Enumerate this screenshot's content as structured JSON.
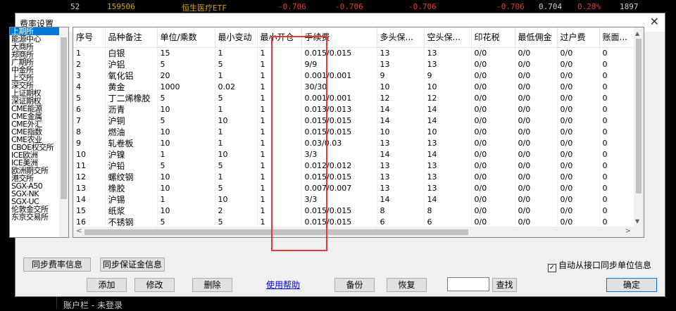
{
  "background": {
    "top_values": [
      "52",
      "159506",
      "恒生医疗ETF",
      "-0.706",
      "-0.706",
      "-0.706",
      "-0.706",
      "0.704",
      "0.28%",
      "1897"
    ],
    "status_text": "账户栏 - 未登录"
  },
  "dialog": {
    "title": "费率设置",
    "close_icon": "✕"
  },
  "exchanges": {
    "items": [
      "上期所",
      "能源中心",
      "大商所",
      "郑商所",
      "广期所",
      "中金所",
      "上交所",
      "深交所",
      "上证期权",
      "深证期权",
      "CME能源",
      "CME金属",
      "CME外汇",
      "CME指数",
      "CME农业",
      "CBOE权交所",
      "ICE欧洲",
      "ICE美洲",
      "欧洲期交所",
      "港交所",
      "SGX-A50",
      "SGX-NK",
      "SGX-UC",
      "伦敦金交所",
      "东京交易所"
    ],
    "selected_index": 0
  },
  "table": {
    "columns": [
      "序号",
      "品种备注",
      "单位/乘数",
      "最小变动",
      "最小开仓",
      "手续费",
      "多头保...",
      "空头保...",
      "印花税",
      "最低佣金",
      "过户费",
      "账面..."
    ],
    "rows": [
      [
        "1",
        "白银",
        "15",
        "1",
        "1",
        "0.015/0.015",
        "13",
        "13",
        "0/0",
        "0/0",
        "0/0",
        "0"
      ],
      [
        "2",
        "沪铝",
        "5",
        "5",
        "1",
        "9/9",
        "13",
        "13",
        "0/0",
        "0/0",
        "0/0",
        "0"
      ],
      [
        "3",
        "氧化铝",
        "20",
        "1",
        "1",
        "0.001/0.001",
        "9",
        "9",
        "0/0",
        "0/0",
        "0/0",
        "0"
      ],
      [
        "4",
        "黄金",
        "1000",
        "0.02",
        "1",
        "30/30",
        "10",
        "10",
        "0/0",
        "0/0",
        "0/0",
        "0"
      ],
      [
        "5",
        "丁二烯橡胶",
        "5",
        "5",
        "1",
        "0.001/0.001",
        "12",
        "12",
        "0/0",
        "0/0",
        "0/0",
        "0"
      ],
      [
        "6",
        "沥青",
        "10",
        "1",
        "1",
        "0.013/0.013",
        "14",
        "14",
        "0/0",
        "0/0",
        "0/0",
        "0"
      ],
      [
        "7",
        "沪铜",
        "5",
        "10",
        "1",
        "0.015/0.015",
        "14",
        "14",
        "0/0",
        "0/0",
        "0/0",
        "0"
      ],
      [
        "8",
        "燃油",
        "10",
        "1",
        "1",
        "0.015/0.015",
        "10",
        "10",
        "0/0",
        "0/0",
        "0/0",
        "0"
      ],
      [
        "9",
        "轧卷板",
        "10",
        "1",
        "1",
        "0.03/0.03",
        "13",
        "13",
        "0/0",
        "0/0",
        "0/0",
        "0"
      ],
      [
        "10",
        "沪镍",
        "1",
        "10",
        "1",
        "3/3",
        "14",
        "14",
        "0/0",
        "0/0",
        "0/0",
        "0"
      ],
      [
        "11",
        "沪铅",
        "5",
        "5",
        "1",
        "0.012/0.012",
        "13",
        "13",
        "0/0",
        "0/0",
        "0/0",
        "0"
      ],
      [
        "12",
        "螺纹钢",
        "10",
        "1",
        "1",
        "0.015/0.015",
        "13",
        "13",
        "0/0",
        "0/0",
        "0/0",
        "0"
      ],
      [
        "13",
        "橡胶",
        "10",
        "5",
        "1",
        "0.007/0.007",
        "13",
        "13",
        "0/0",
        "0/0",
        "0/0",
        "0"
      ],
      [
        "14",
        "沪锡",
        "1",
        "10",
        "1",
        "3/3",
        "14",
        "14",
        "0/0",
        "0/0",
        "0/0",
        "0"
      ],
      [
        "15",
        "纸浆",
        "10",
        "2",
        "1",
        "0.015/0.015",
        "8",
        "8",
        "0/0",
        "0/0",
        "0/0",
        "0"
      ],
      [
        "16",
        "不锈钢",
        "5",
        "5",
        "1",
        "0.015/0.015",
        "6",
        "6",
        "0/0",
        "0/0",
        "0/0",
        "0"
      ]
    ]
  },
  "buttons": {
    "sync_rates": "同步费率信息",
    "sync_margin": "同步保证金信息",
    "auto_sync_label": "自动从接口同步单位信息",
    "auto_sync_checked": true,
    "add": "添加",
    "edit": "修改",
    "delete": "删除",
    "help": "使用帮助",
    "backup": "备份",
    "restore": "恢复",
    "search_value": "",
    "find": "查找",
    "ok": "确定"
  },
  "colors": {
    "highlight": "#e53935",
    "selection": "#0078d7",
    "bg_red": "#e53935",
    "bg_orange": "#d9a400"
  }
}
